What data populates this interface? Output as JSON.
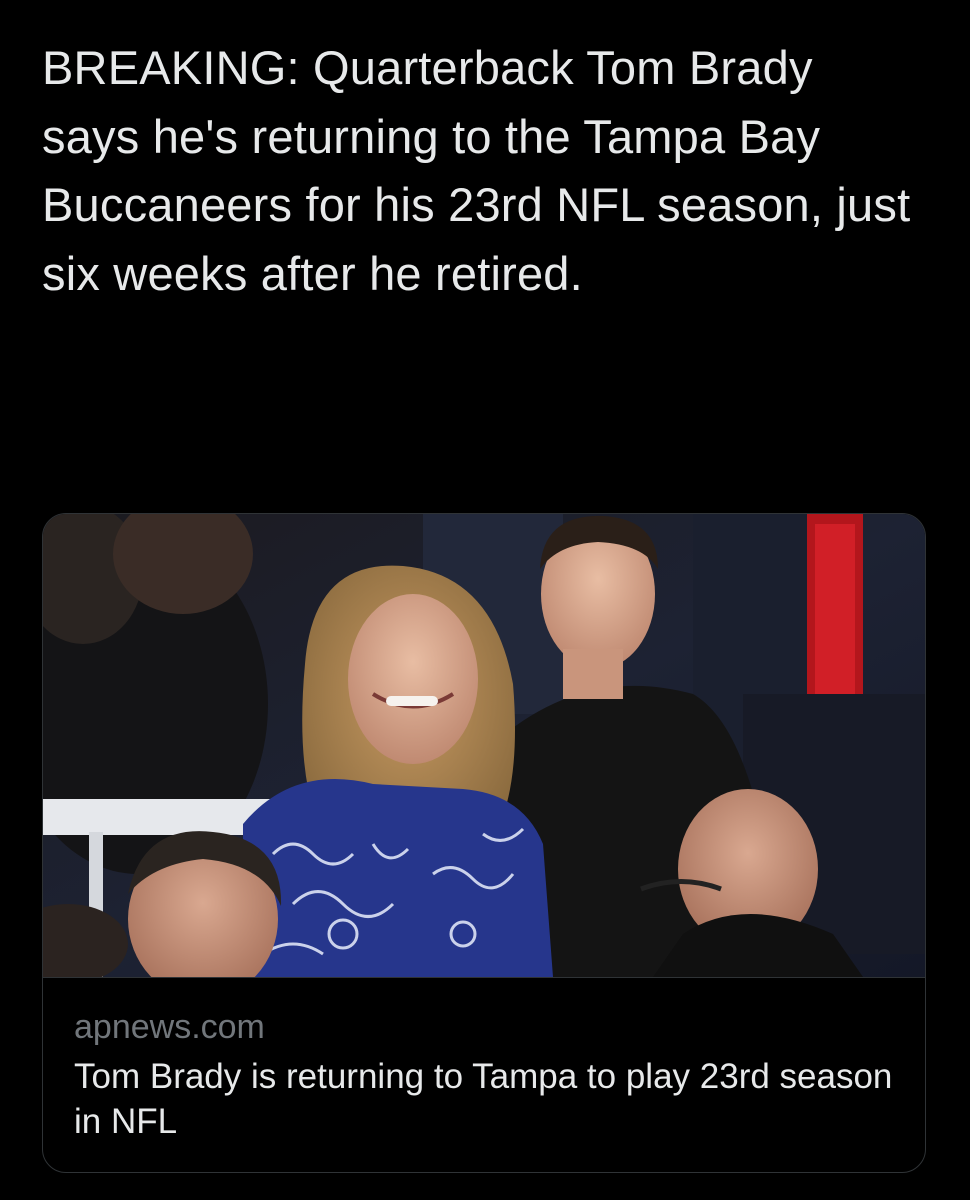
{
  "tweet": {
    "text": "BREAKING: Quarterback Tom Brady says he's returning to the Tampa Bay Buccaneers for his 23rd NFL season, just six weeks after he retired."
  },
  "link_card": {
    "domain": "apnews.com",
    "title": "Tom Brady is returning to Tampa to play 23rd season in NFL",
    "image": {
      "icon": "news-photo"
    }
  },
  "colors": {
    "background": "#000000",
    "text_primary": "#e7e9ea",
    "text_secondary": "#71767b",
    "card_border": "#2f3336"
  }
}
